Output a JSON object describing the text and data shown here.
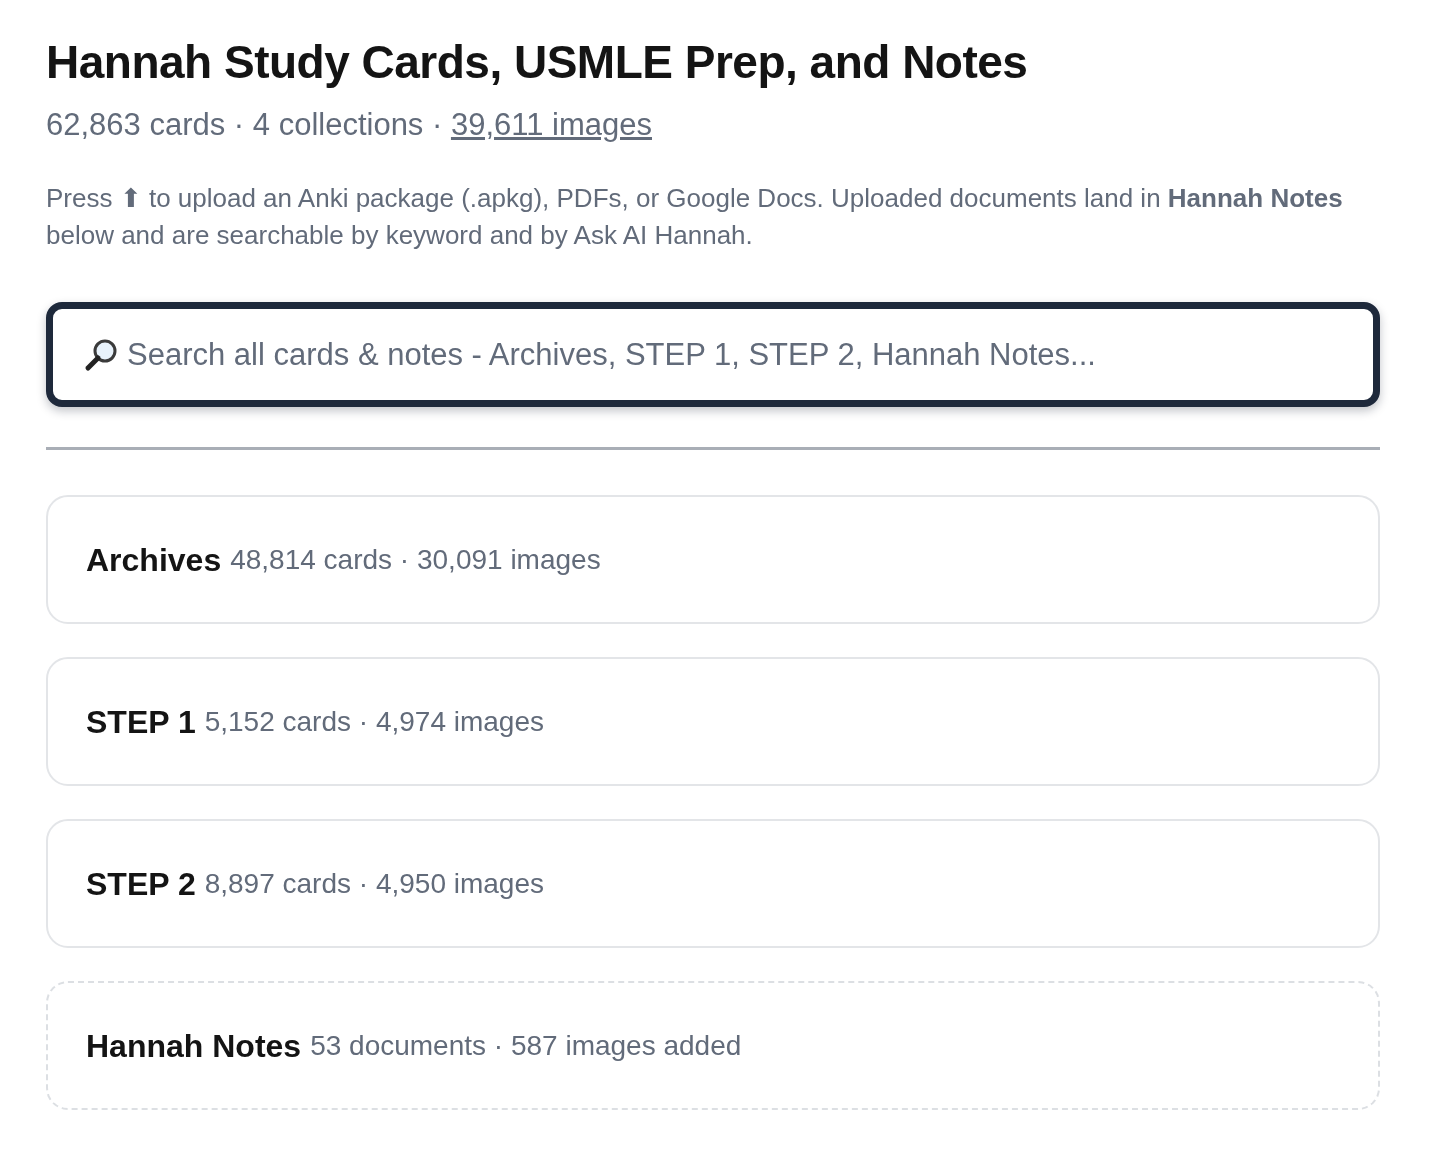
{
  "header": {
    "title": "Hannah Study Cards, USMLE Prep, and Notes",
    "summary": "62,863 cards · 4 collections · ",
    "images_link": "39,611 images",
    "description": "Press ⬆ to upload an Anki package (.apkg), PDFs, or Google Docs. Uploaded documents land in **Hannah Notes** below and are searchable by keyword and by Ask AI Hannah."
  },
  "search": {
    "placeholder": "Search all cards & notes - Archives, STEP 1, STEP 2, Hannah Notes..."
  },
  "collections": [
    {
      "kind": "deck",
      "name": "Archives",
      "meta": "48,814 cards · 30,091 images"
    },
    {
      "kind": "deck",
      "name": "STEP 1",
      "meta": "5,152 cards · 4,974 images"
    },
    {
      "kind": "deck",
      "name": "STEP 2",
      "meta": "8,897 cards · 4,950 images"
    },
    {
      "kind": "notes",
      "name": "Hannah Notes",
      "meta": "53 documents · 587 images added"
    }
  ]
}
